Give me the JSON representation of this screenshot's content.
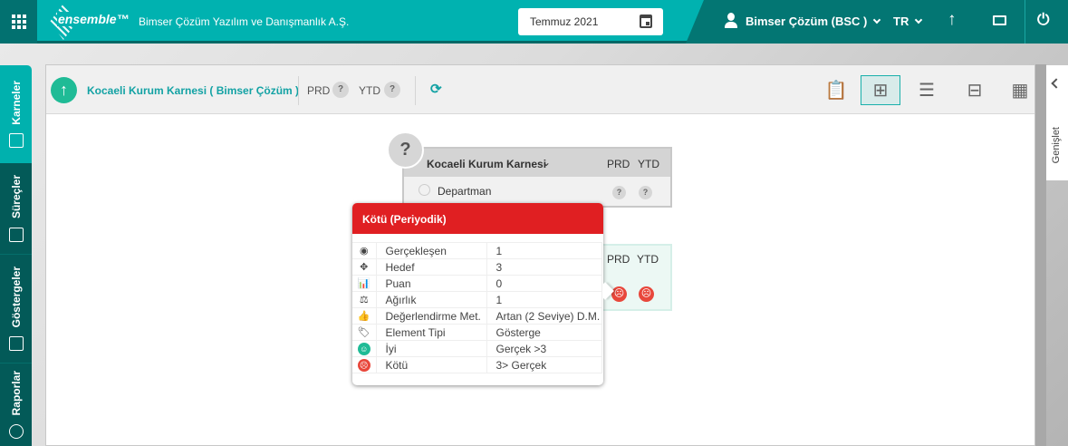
{
  "topbar": {
    "company": "Bimser Çözüm Yazılım ve Danışmanlık A.Ş.",
    "logo": "ensemble™",
    "date": "Temmuz 2021",
    "user": "Bimser Çözüm (BSC )",
    "language": "TR"
  },
  "sidebar": {
    "items": [
      {
        "label": "Karneler"
      },
      {
        "label": "Süreçler"
      },
      {
        "label": "Göstergeler"
      },
      {
        "label": "Raporlar"
      }
    ]
  },
  "header": {
    "title": "Kocaeli Kurum Karnesi ( Bimser Çözüm )",
    "prd": "PRD",
    "ytd": "YTD",
    "q": "?"
  },
  "right_panel": {
    "label": "Genişlet"
  },
  "card1": {
    "title": "Kocaeli Kurum Karnesi",
    "prd": "PRD",
    "ytd": "YTD",
    "row": "Departman",
    "q": "?"
  },
  "card2": {
    "prd": "PRD",
    "ytd": "YTD"
  },
  "tooltip": {
    "title": "Kötü (Periyodik)",
    "rows": [
      {
        "icon": "target-dot",
        "label": "Gerçekleşen",
        "value": "1"
      },
      {
        "icon": "crosshair",
        "label": "Hedef",
        "value": "3"
      },
      {
        "icon": "bar-chart",
        "label": "Puan",
        "value": "0"
      },
      {
        "icon": "scale",
        "label": "Ağırlık",
        "value": "1"
      },
      {
        "icon": "thumbs-up",
        "label": "Değerlendirme Met.",
        "value": "Artan (2 Seviye) D.M."
      },
      {
        "icon": "tag",
        "label": "Element Tipi",
        "value": "Gösterge"
      },
      {
        "icon": "smile",
        "label": "İyi",
        "value": "Gerçek >3"
      },
      {
        "icon": "frown",
        "label": "Kötü",
        "value": "3> Gerçek"
      }
    ]
  },
  "colors": {
    "teal": "#00b2b0",
    "dark_teal": "#037673",
    "bad": "#e8473b",
    "good": "#1fbb96",
    "tooltip_header": "#e01f22"
  }
}
